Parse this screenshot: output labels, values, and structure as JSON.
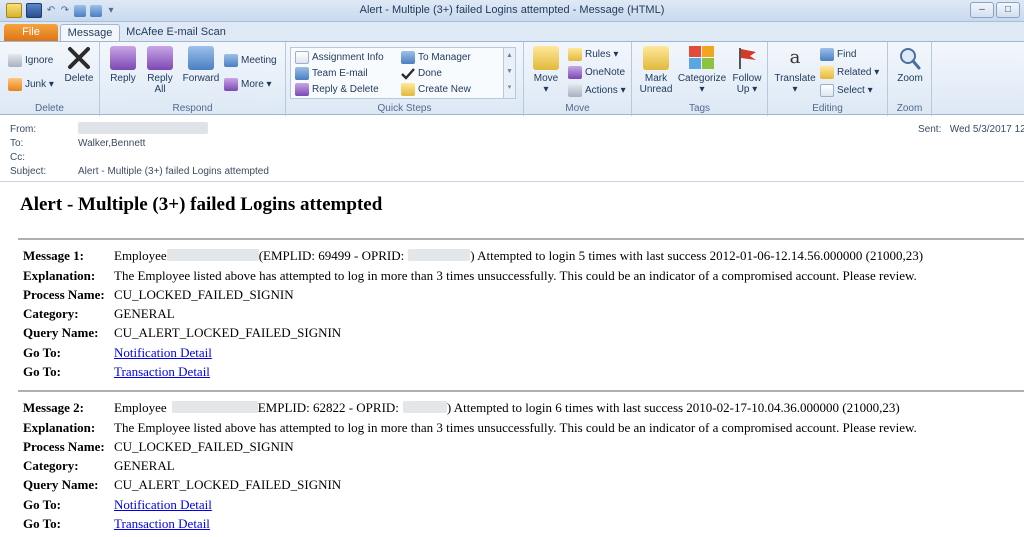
{
  "window": {
    "title": "Alert - Multiple (3+) failed Logins attempted  -  Message (HTML)",
    "controls": [
      "–",
      "□"
    ]
  },
  "qat": {
    "undo": "↶",
    "redo": "↷",
    "customize": "▾"
  },
  "tabs": [
    "File",
    "Message",
    "McAfee E-mail Scan"
  ],
  "ribbon": {
    "delete_group": {
      "label": "Delete",
      "ignore": "Ignore",
      "junk": "Junk ▾",
      "delete": "Delete"
    },
    "respond_group": {
      "label": "Respond",
      "reply": "Reply",
      "reply_all": "Reply All",
      "forward": "Forward",
      "meeting": "Meeting",
      "more": "More ▾"
    },
    "quick_steps": {
      "label": "Quick Steps",
      "items": [
        "Assignment Info",
        "Team E-mail",
        "Reply & Delete",
        "To Manager",
        "Done",
        "Create New"
      ]
    },
    "move_group": {
      "label": "Move",
      "move": "Move",
      "move_arrow": "▾",
      "rules": "Rules ▾",
      "onenote": "OneNote",
      "actions": "Actions ▾"
    },
    "tags_group": {
      "label": "Tags",
      "mark_unread": "Mark Unread",
      "categorize": "Categorize",
      "categorize_arrow": "▾",
      "follow_up": "Follow Up ▾"
    },
    "editing_group": {
      "label": "Editing",
      "translate": "Translate",
      "translate_arrow": "▾",
      "find": "Find",
      "related": "Related ▾",
      "select": "Select ▾"
    },
    "zoom_group": {
      "label": "Zoom",
      "zoom": "Zoom"
    }
  },
  "header": {
    "from_label": "From:",
    "to_label": "To:",
    "to_value": "Walker,Bennett",
    "cc_label": "Cc:",
    "subject_label": "Subject:",
    "subject_value": "Alert - Multiple (3+) failed Logins attempted",
    "sent_label": "Sent:",
    "sent_value": "Wed 5/3/2017 12"
  },
  "email": {
    "title": "Alert - Multiple (3+) failed Logins attempted",
    "messages": [
      {
        "label": "Message 1:",
        "employee_prefix": "Employee",
        "emplid_text": "(EMPLID: 69499 - OPRID:",
        "attempt_text": ") Attempted to login 5 times with last success 2012-01-06-12.14.56.000000 (21000,23)",
        "explanation_label": "Explanation:",
        "explanation": "The Employee listed above has attempted to log in more than 3 times unsuccessfully. This could be an indicator of a compromised account. Please review.",
        "process_label": "Process Name:",
        "process": "CU_LOCKED_FAILED_SIGNIN",
        "category_label": "Category:",
        "category": "GENERAL",
        "query_label": "Query Name:",
        "query": "CU_ALERT_LOCKED_FAILED_SIGNIN",
        "goto_label": "Go To:",
        "notification_link": "Notification Detail",
        "transaction_link": "Transaction Detail"
      },
      {
        "label": "Message 2:",
        "employee_prefix": "Employee",
        "emplid_text": "EMPLID: 62822 - OPRID:",
        "attempt_text": ") Attempted to login 6 times with last success 2010-02-17-10.04.36.000000 (21000,23)",
        "explanation_label": "Explanation:",
        "explanation": "The Employee listed above has attempted to log in more than 3 times unsuccessfully. This could be an indicator of a compromised account. Please review.",
        "process_label": "Process Name:",
        "process": "CU_LOCKED_FAILED_SIGNIN",
        "category_label": "Category:",
        "category": "GENERAL",
        "query_label": "Query Name:",
        "query": "CU_ALERT_LOCKED_FAILED_SIGNIN",
        "goto_label": "Go To:",
        "notification_link": "Notification Detail",
        "transaction_link": "Transaction Detail"
      }
    ]
  }
}
